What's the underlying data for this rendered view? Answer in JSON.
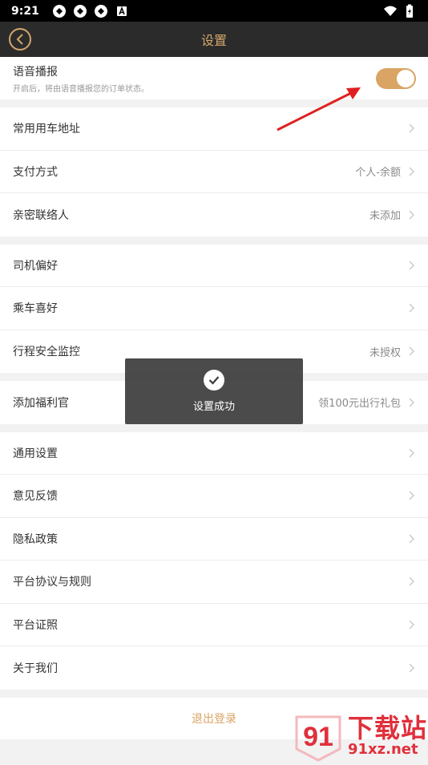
{
  "statusbar": {
    "time": "9:21"
  },
  "nav": {
    "title": "设置"
  },
  "voice": {
    "title": "语音播报",
    "desc": "开启后，将由语音播报您的订单状态。",
    "enabled": true
  },
  "group1": [
    {
      "label": "常用用车地址",
      "value": ""
    },
    {
      "label": "支付方式",
      "value": "个人-余额"
    },
    {
      "label": "亲密联络人",
      "value": "未添加"
    }
  ],
  "group2": [
    {
      "label": "司机偏好",
      "value": ""
    },
    {
      "label": "乘车喜好",
      "value": ""
    },
    {
      "label": "行程安全监控",
      "value": "未授权"
    }
  ],
  "group3": [
    {
      "label": "添加福利官",
      "value": "领100元出行礼包"
    }
  ],
  "group4": [
    {
      "label": "通用设置",
      "value": ""
    },
    {
      "label": "意见反馈",
      "value": ""
    },
    {
      "label": "隐私政策",
      "value": ""
    },
    {
      "label": "平台协议与规则",
      "value": ""
    },
    {
      "label": "平台证照",
      "value": ""
    },
    {
      "label": "关于我们",
      "value": ""
    }
  ],
  "logout": {
    "label": "退出登录"
  },
  "toast": {
    "text": "设置成功"
  },
  "watermark": {
    "brand": "下载站",
    "url": "91xz.net",
    "badge": "91"
  },
  "colors": {
    "accent": "#d9a464",
    "navbar": "#2b2b2b",
    "toast_bg": "#3c3c3c",
    "arrow": "#e02020"
  }
}
